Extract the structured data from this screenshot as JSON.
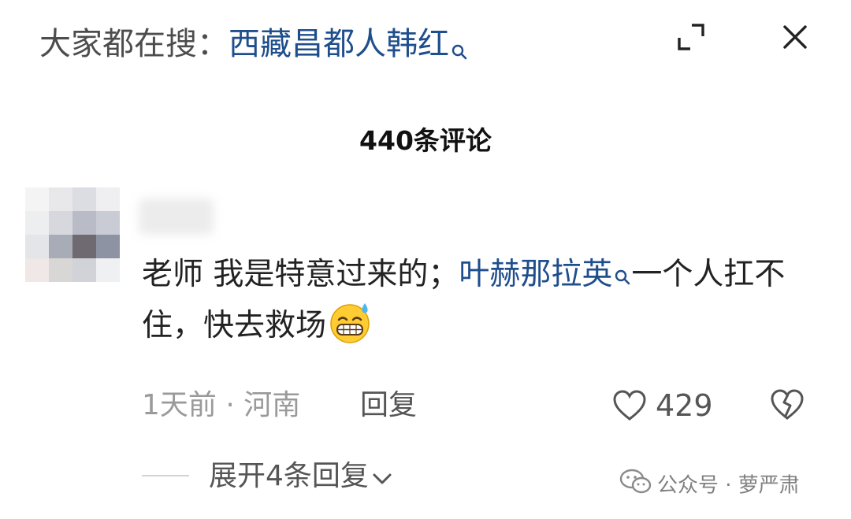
{
  "search": {
    "prefix": "大家都在搜：",
    "query": "西藏昌都人韩红",
    "icons": [
      "search-icon",
      "expand-icon",
      "close-icon"
    ]
  },
  "comments": {
    "count_label": "440条评论"
  },
  "comment": {
    "text_before": "老师 我是特意过来的；",
    "mention": "叶赫那拉英",
    "text_after": "一个人扛不住，快去救场",
    "emoji": "grinning-sweat-emoji",
    "meta": "1天前 · 河南",
    "reply_label": "回复",
    "likes": "429",
    "expand_replies": "展开4条回复"
  },
  "watermark": {
    "text": "公众号 · 萝严肃"
  },
  "colors": {
    "link": "#1f4e8c",
    "text": "#222222",
    "muted": "#9a9a9a"
  }
}
